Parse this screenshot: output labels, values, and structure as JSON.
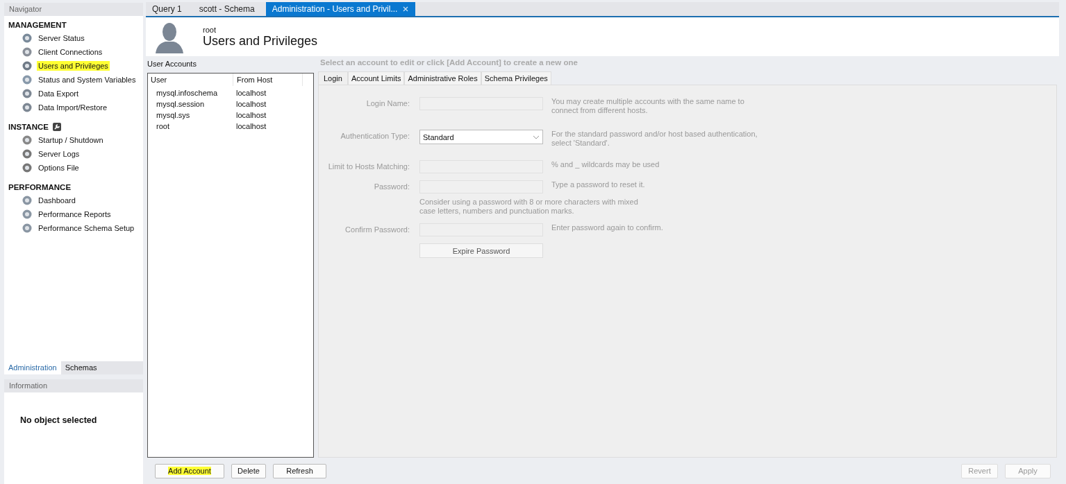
{
  "navigator": {
    "title": "Navigator",
    "sections": [
      {
        "title": "MANAGEMENT",
        "items": [
          {
            "label": "Server Status",
            "highlighted": false
          },
          {
            "label": "Client Connections",
            "highlighted": false
          },
          {
            "label": "Users and Privileges",
            "highlighted": true
          },
          {
            "label": "Status and System Variables",
            "highlighted": false
          },
          {
            "label": "Data Export",
            "highlighted": false
          },
          {
            "label": "Data Import/Restore",
            "highlighted": false
          }
        ]
      },
      {
        "title": "INSTANCE",
        "items": [
          {
            "label": "Startup / Shutdown",
            "highlighted": false
          },
          {
            "label": "Server Logs",
            "highlighted": false
          },
          {
            "label": "Options File",
            "highlighted": false
          }
        ]
      },
      {
        "title": "PERFORMANCE",
        "items": [
          {
            "label": "Dashboard",
            "highlighted": false
          },
          {
            "label": "Performance Reports",
            "highlighted": false
          },
          {
            "label": "Performance Schema Setup",
            "highlighted": false
          }
        ]
      }
    ],
    "tabs": [
      {
        "label": "Administration",
        "selected": true
      },
      {
        "label": "Schemas",
        "selected": false
      }
    ]
  },
  "information": {
    "title": "Information",
    "message": "No object selected"
  },
  "editor_tabs": [
    {
      "label": "Query 1",
      "selected": false,
      "closable": false
    },
    {
      "label": "scott - Schema",
      "selected": false,
      "closable": false
    },
    {
      "label": "Administration - Users and Privil...",
      "selected": true,
      "closable": true
    }
  ],
  "header": {
    "user": "root",
    "title": "Users and Privileges"
  },
  "accounts": {
    "title": "User Accounts",
    "columns": [
      "User",
      "From Host"
    ],
    "rows": [
      [
        "mysql.infoschema",
        "localhost"
      ],
      [
        "mysql.session",
        "localhost"
      ],
      [
        "mysql.sys",
        "localhost"
      ],
      [
        "root",
        "localhost"
      ]
    ]
  },
  "buttons": [
    {
      "label": "Add Account",
      "highlighted": true
    },
    {
      "label": "Delete",
      "highlighted": false
    },
    {
      "label": "Refresh",
      "highlighted": false
    }
  ],
  "details": {
    "prompt": "Select an account to edit or click [Add Account] to create a new one",
    "tabs": [
      {
        "label": "Login",
        "selected": true
      },
      {
        "label": "Account Limits",
        "selected": false
      },
      {
        "label": "Administrative Roles",
        "selected": false
      },
      {
        "label": "Schema Privileges",
        "selected": false
      }
    ],
    "fields": [
      {
        "kind": "input",
        "label": "Login Name:",
        "hint": "You may create multiple accounts with the same name to connect from different hosts."
      },
      {
        "kind": "select",
        "label": "Authentication Type:",
        "value": "Standard",
        "hint": "For the standard password and/or host based authentication, select 'Standard'."
      },
      {
        "kind": "input",
        "label": "Limit to Hosts Matching:",
        "hint": "% and _ wildcards may be used"
      },
      {
        "kind": "input",
        "label": "Password:",
        "hint": "Type a password to reset it."
      },
      {
        "kind": "note",
        "hint": "Consider using a password with 8 or more characters with mixed case letters, numbers and punctuation marks."
      },
      {
        "kind": "input",
        "label": "Confirm Password:",
        "hint": "Enter password again to confirm."
      },
      {
        "kind": "button",
        "label": "Expire Password"
      }
    ]
  },
  "actions": [
    {
      "label": "Revert",
      "disabled": true
    },
    {
      "label": "Apply",
      "disabled": true
    }
  ]
}
